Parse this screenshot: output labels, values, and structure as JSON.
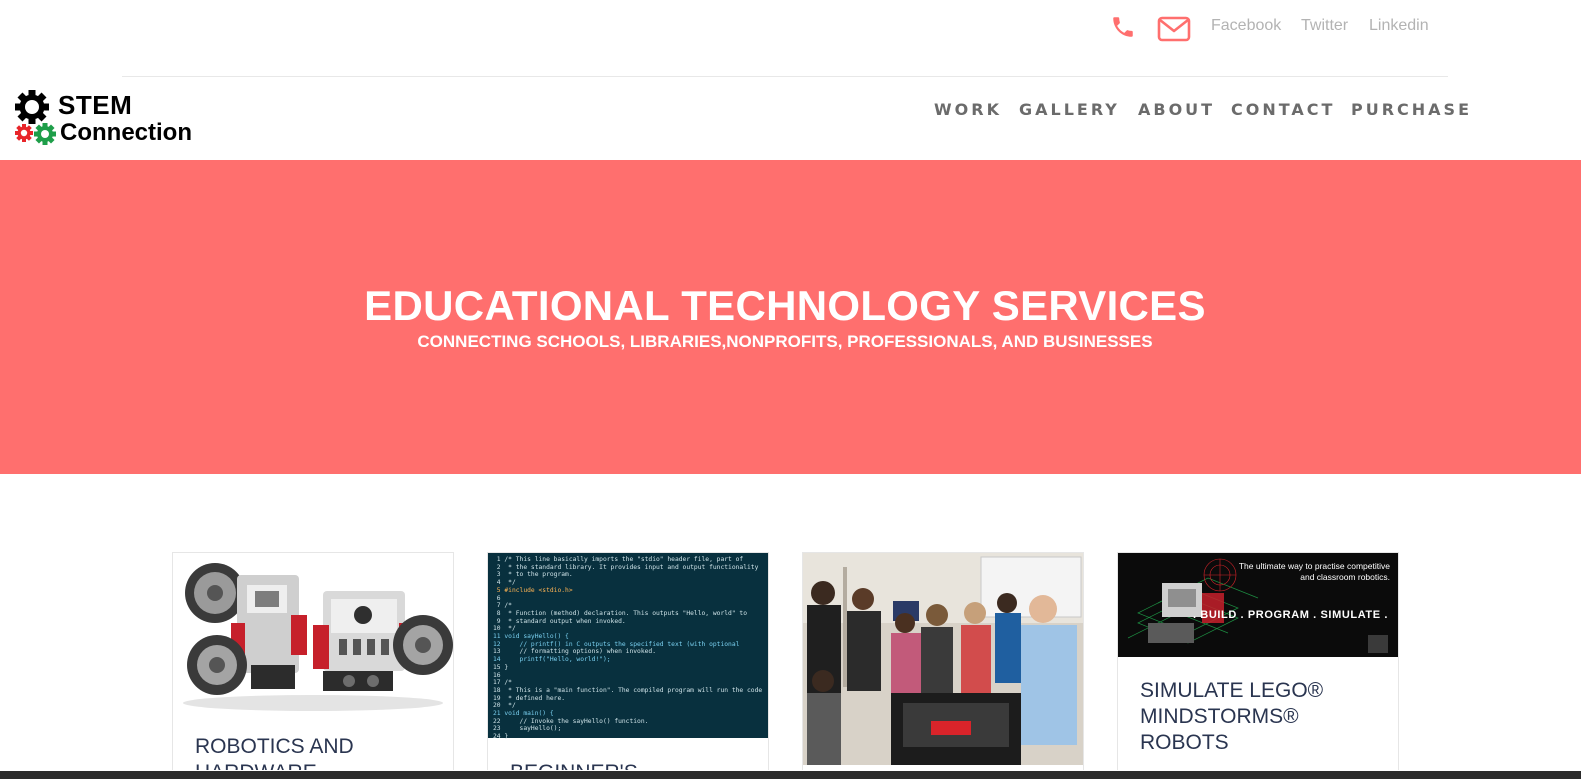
{
  "top_bar": {
    "phone_icon": "phone-icon",
    "mail_icon": "mail-icon",
    "social_links": {
      "facebook": "Facebook",
      "twitter": "Twitter",
      "linkedin": "Linkedin"
    },
    "icon_color": "#ff6f6e",
    "link_color": "#b3b3b3"
  },
  "logo": {
    "line1": "STEM",
    "line2": "Connection",
    "gear_colors": [
      "#000000",
      "#e8252a",
      "#1e9e49"
    ]
  },
  "nav": {
    "items": {
      "work": "WORK",
      "gallery": "GALLERY",
      "about": "ABOUT",
      "contact": "CONTACT",
      "purchase": "PURCHASE"
    }
  },
  "hero": {
    "title": "EDUCATIONAL TECHNOLOGY SERVICES",
    "subtitle": "CONNECTING SCHOOLS, LIBRARIES,NONPROFITS, PROFESSIONALS, AND BUSINESSES",
    "background": "#ff6f6e"
  },
  "cards": {
    "robotics": {
      "title": "ROBOTICS AND HARDWARE"
    },
    "beginners": {
      "title": "BEGINNER'S",
      "code_lines": [
        " 1 /* This line basically imports the \"stdio\" header file, part of",
        " 2  * the standard library. It provides input and output functionality",
        " 3  * to the program.",
        " 4  */",
        " 5 #include <stdio.h>",
        " 6",
        " 7 /*",
        " 8  * Function (method) declaration. This outputs \"Hello, world\" to",
        " 9  * standard output when invoked.",
        "10  */",
        "11 void sayHello() {",
        "12     // printf() in C outputs the specified text (with optional",
        "13     // formatting options) when invoked.",
        "14     printf(\"Hello, world!\");",
        "15 }",
        "16",
        "17 /*",
        "18  * This is a \"main function\". The compiled program will run the code",
        "19  * defined here.",
        "20  */",
        "21 void main() {",
        "22     // Invoke the sayHello() function.",
        "23     sayHello();",
        "24 }"
      ]
    },
    "classroom": {
      "title": ""
    },
    "simulate": {
      "title": "SIMULATE LEGO® MINDSTORMS® ROBOTS",
      "image_tagline_1": "The ultimate way to practise competitive",
      "image_tagline_2": "and classroom robotics.",
      "image_banner": ". BUILD . PROGRAM . SIMULATE ."
    },
    "title_color": "#2a3550"
  }
}
